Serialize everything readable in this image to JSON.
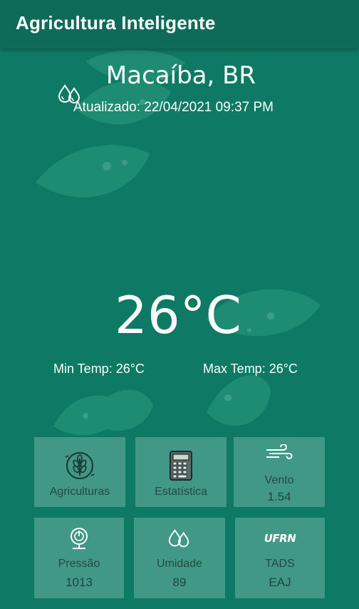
{
  "appbar": {
    "title": "Agricultura Inteligente"
  },
  "location": {
    "city": "Macaíba, BR",
    "updated": "Atualizado: 22/04/2021 09:37 PM"
  },
  "weather": {
    "temp": "26°C",
    "min": "Min Temp: 26°C",
    "max": "Max Temp: 26°C"
  },
  "tiles": [
    {
      "label": "Agriculturas",
      "icon": "wheat-icon"
    },
    {
      "label": "Estatística",
      "icon": "calculator-icon"
    },
    {
      "label": "Vento",
      "value": "1.54",
      "icon": "wind-icon"
    },
    {
      "label": "Pressão",
      "value": "1013",
      "icon": "pressure-icon"
    },
    {
      "label": "Umidade",
      "value": "89",
      "icon": "humidity-icon"
    },
    {
      "label": "TADS",
      "value": "EAJ",
      "icon": "ufrn-logo",
      "logo_text": "UFRN"
    }
  ],
  "colors": {
    "background": "#0e7a66",
    "appbar": "#0d6b58",
    "tile": "#5fa596",
    "text": "#ffffff"
  }
}
